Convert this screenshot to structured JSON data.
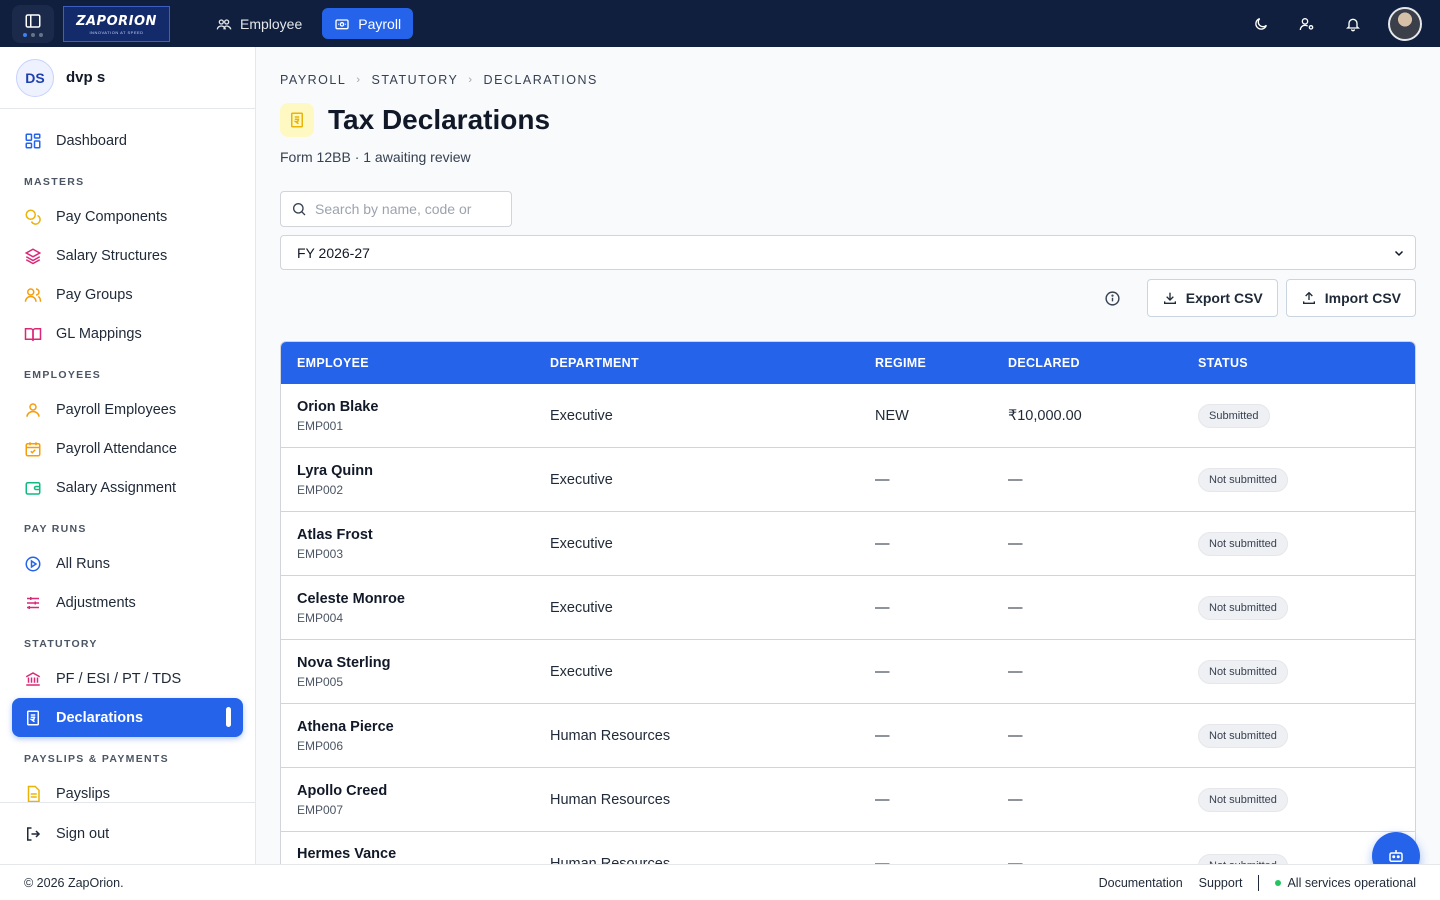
{
  "topbar": {
    "logo_text": "ZAPORION",
    "logo_tagline": "INNOVATION AT SPEED",
    "nav": [
      {
        "label": "Employee",
        "icon": "people-icon",
        "active": false
      },
      {
        "label": "Payroll",
        "icon": "wallet-icon",
        "active": true
      }
    ],
    "icons": [
      "moon-icon",
      "user-settings-icon",
      "bell-icon",
      "avatar"
    ]
  },
  "sidebar": {
    "user": {
      "initials": "DS",
      "name": "dvp s"
    },
    "dashboard_label": "Dashboard",
    "sections": {
      "masters": "MASTERS",
      "employees": "EMPLOYEES",
      "pay_runs": "PAY RUNS",
      "statutory": "STATUTORY",
      "payslips": "PAYSLIPS & PAYMENTS"
    },
    "items": {
      "pay_components": "Pay Components",
      "salary_structures": "Salary Structures",
      "pay_groups": "Pay Groups",
      "gl_mappings": "GL Mappings",
      "payroll_employees": "Payroll Employees",
      "payroll_attendance": "Payroll Attendance",
      "salary_assignment": "Salary Assignment",
      "all_runs": "All Runs",
      "adjustments": "Adjustments",
      "pf_esi": "PF / ESI / PT / TDS",
      "declarations": "Declarations",
      "payslips": "Payslips"
    },
    "signout_label": "Sign out"
  },
  "breadcrumb": [
    "PAYROLL",
    "STATUTORY",
    "DECLARATIONS"
  ],
  "page": {
    "title": "Tax Declarations",
    "subtitle": "Form 12BB · 1 awaiting review"
  },
  "search": {
    "placeholder": "Search by name, code or",
    "value": ""
  },
  "fy_select": {
    "selected": "FY 2026-27"
  },
  "toolbar": {
    "export_label": "Export CSV",
    "import_label": "Import CSV"
  },
  "table": {
    "headers": [
      "EMPLOYEE",
      "DEPARTMENT",
      "REGIME",
      "DECLARED",
      "STATUS"
    ],
    "rows": [
      {
        "name": "Orion Blake",
        "code": "EMP001",
        "department": "Executive",
        "regime": "NEW",
        "declared": "₹10,000.00",
        "status": "Submitted"
      },
      {
        "name": "Lyra Quinn",
        "code": "EMP002",
        "department": "Executive",
        "regime": "—",
        "declared": "—",
        "status": "Not submitted"
      },
      {
        "name": "Atlas Frost",
        "code": "EMP003",
        "department": "Executive",
        "regime": "—",
        "declared": "—",
        "status": "Not submitted"
      },
      {
        "name": "Celeste Monroe",
        "code": "EMP004",
        "department": "Executive",
        "regime": "—",
        "declared": "—",
        "status": "Not submitted"
      },
      {
        "name": "Nova Sterling",
        "code": "EMP005",
        "department": "Executive",
        "regime": "—",
        "declared": "—",
        "status": "Not submitted"
      },
      {
        "name": "Athena Pierce",
        "code": "EMP006",
        "department": "Human Resources",
        "regime": "—",
        "declared": "—",
        "status": "Not submitted"
      },
      {
        "name": "Apollo Creed",
        "code": "EMP007",
        "department": "Human Resources",
        "regime": "—",
        "declared": "—",
        "status": "Not submitted"
      },
      {
        "name": "Hermes Vance",
        "code": "",
        "department": "Human Resources",
        "regime": "—",
        "declared": "—",
        "status": "Not submitted"
      }
    ]
  },
  "footer": {
    "copyright": "© 2026 ZapOrion.",
    "documentation": "Documentation",
    "support": "Support",
    "status": "All services operational"
  },
  "colors": {
    "primary": "#2563eb",
    "topbar": "#0f1f3d",
    "status_ok": "#22c55e"
  }
}
